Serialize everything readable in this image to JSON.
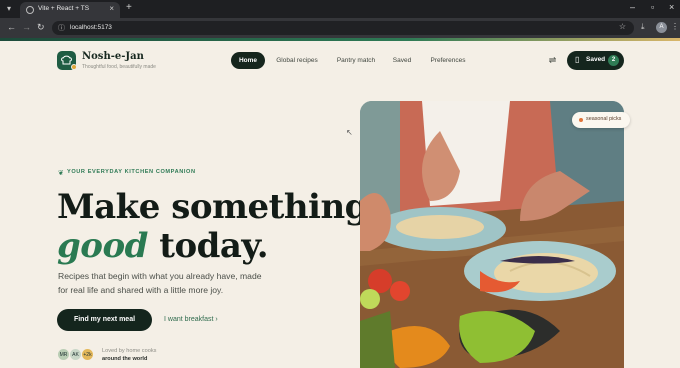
{
  "browser": {
    "tab_title": "Vite + React + TS",
    "url": "localhost:5173",
    "profile_initial": "A"
  },
  "brand": {
    "name": "Nosh-e-Jan",
    "tagline": "Thoughtful food, beautifully made"
  },
  "nav": {
    "items": [
      {
        "label": "Home"
      },
      {
        "label": "Global recipes"
      },
      {
        "label": "Pantry match"
      },
      {
        "label": "Saved"
      },
      {
        "label": "Preferences"
      }
    ],
    "saved_button": {
      "label": "Saved",
      "count": "2"
    }
  },
  "hero": {
    "eyebrow": "YOUR EVERYDAY KITCHEN COMPANION",
    "headline_line1": "Make something",
    "headline_em": "good",
    "headline_rest": "today.",
    "lead_line1": "Recipes that begin with what you already have, made",
    "lead_line2": "for real life and shared with a little more joy.",
    "cta_primary": "Find my next meal",
    "cta_secondary": "I want breakfast",
    "avatars": [
      "MR",
      "AK",
      "+2k"
    ],
    "social_line1": "Loved by home cooks",
    "social_line2": "around the world",
    "image_chip": "seasonal picks"
  }
}
